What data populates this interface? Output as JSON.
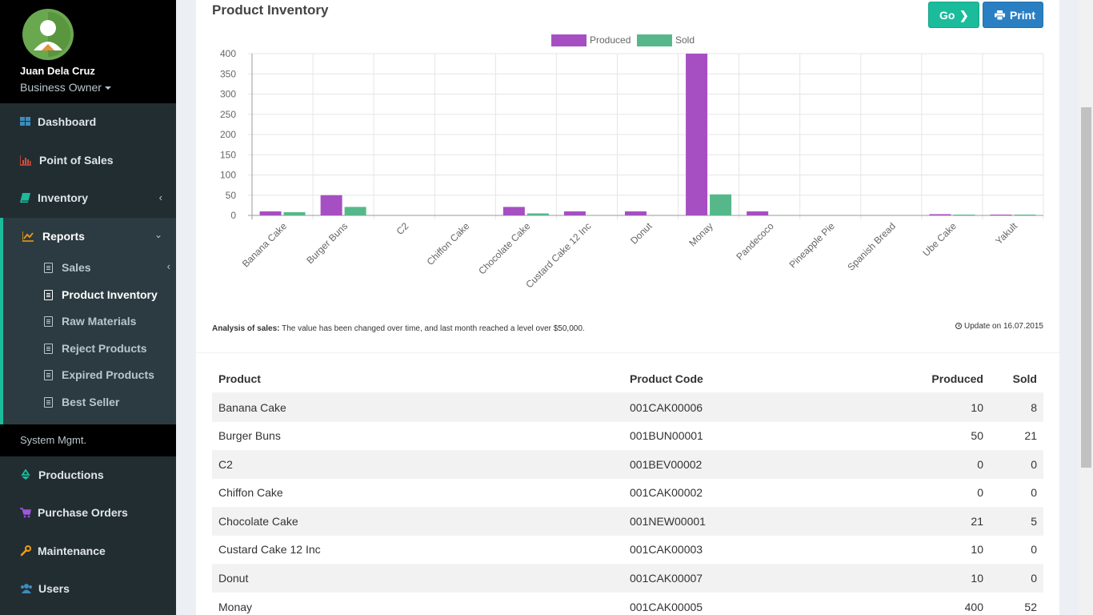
{
  "user": {
    "name": "Juan Dela Cruz",
    "role": "Business Owner"
  },
  "sidebar": {
    "items": [
      {
        "label": "Dashboard"
      },
      {
        "label": "Point of Sales"
      },
      {
        "label": "Inventory"
      },
      {
        "label": "Reports"
      }
    ],
    "reports_sub": [
      {
        "label": "Sales"
      },
      {
        "label": "Product Inventory"
      },
      {
        "label": "Raw Materials"
      },
      {
        "label": "Reject Products"
      },
      {
        "label": "Expired Products"
      },
      {
        "label": "Best Seller"
      }
    ],
    "section_header": "System Mgmt.",
    "system_items": [
      {
        "label": "Productions"
      },
      {
        "label": "Purchase Orders"
      },
      {
        "label": "Maintenance"
      },
      {
        "label": "Users"
      }
    ]
  },
  "main": {
    "title": "Product Inventory",
    "go_label": "Go",
    "print_label": "Print",
    "analysis_label": "Analysis of sales:",
    "analysis_text": " The value has been changed over time, and last month reached a level over $50,000.",
    "update_text": "Update on 16.07.2015"
  },
  "colors": {
    "produced": "#a64fc2",
    "sold": "#56b88a",
    "accent": "#1abc9c",
    "print": "#2a7fc2"
  },
  "chart_data": {
    "type": "bar",
    "categories": [
      "Banana Cake",
      "Burger Buns",
      "C2",
      "Chiffon Cake",
      "Chocolate Cake",
      "Custard Cake 12 Inc",
      "Donut",
      "Monay",
      "Pandecoco",
      "Pineapple Pie",
      "Spanish Bread",
      "Ube Cake",
      "Yakult"
    ],
    "series": [
      {
        "name": "Produced",
        "values": [
          10,
          50,
          0,
          0,
          21,
          10,
          10,
          400,
          10,
          0,
          0,
          3,
          2
        ]
      },
      {
        "name": "Sold",
        "values": [
          8,
          21,
          0,
          0,
          5,
          0,
          0,
          52,
          0,
          0,
          0,
          2,
          2
        ]
      }
    ],
    "yticks": [
      "0",
      "50",
      "100",
      "150",
      "200",
      "250",
      "300",
      "350",
      "400"
    ],
    "ylim": [
      0,
      400
    ],
    "legend": "top-center",
    "grid": true
  },
  "table": {
    "headers": [
      "Product",
      "Product Code",
      "Produced",
      "Sold"
    ],
    "rows": [
      [
        "Banana Cake",
        "001CAK00006",
        "10",
        "8"
      ],
      [
        "Burger Buns",
        "001BUN00001",
        "50",
        "21"
      ],
      [
        "C2",
        "001BEV00002",
        "0",
        "0"
      ],
      [
        "Chiffon Cake",
        "001CAK00002",
        "0",
        "0"
      ],
      [
        "Chocolate Cake",
        "001NEW00001",
        "21",
        "5"
      ],
      [
        "Custard Cake 12 Inc",
        "001CAK00003",
        "10",
        "0"
      ],
      [
        "Donut",
        "001CAK00007",
        "10",
        "0"
      ],
      [
        "Monay",
        "001CAK00005",
        "400",
        "52"
      ]
    ]
  }
}
